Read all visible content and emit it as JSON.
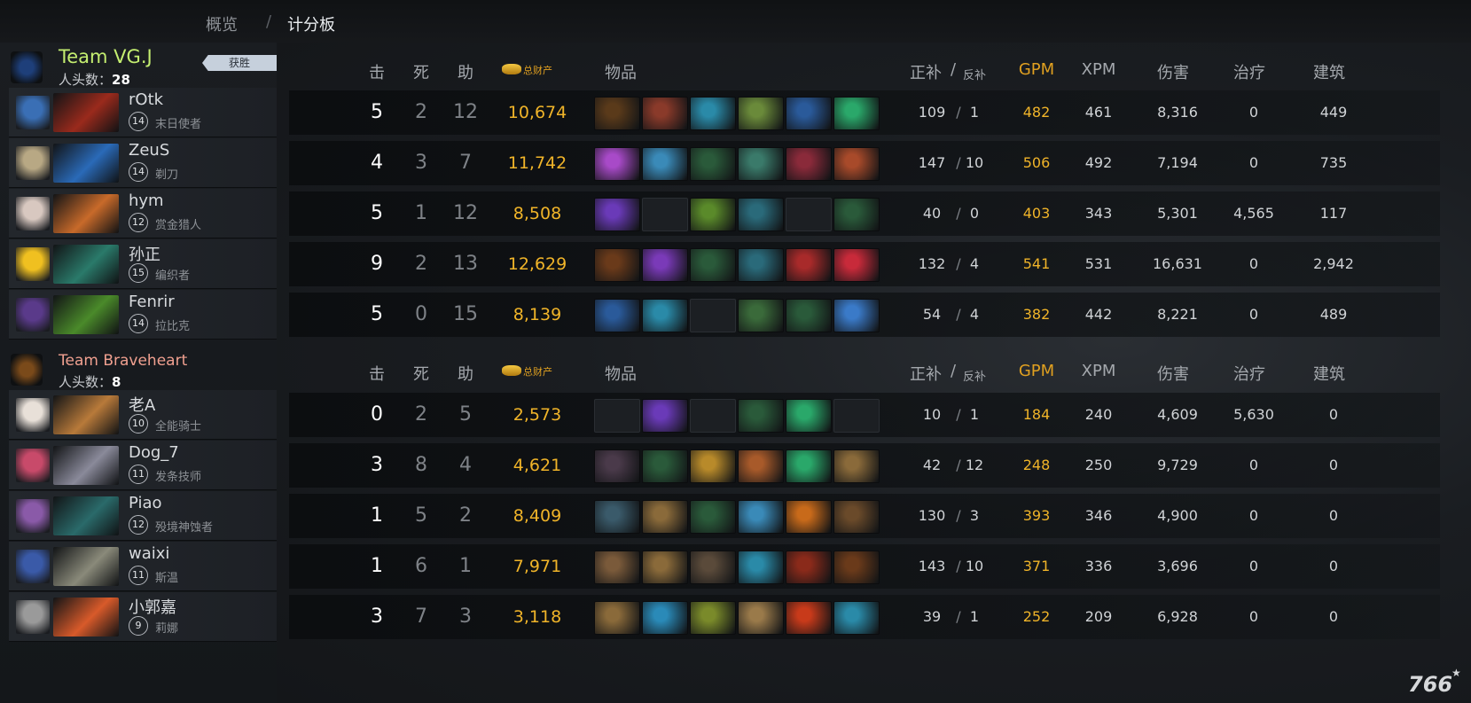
{
  "nav": {
    "overview_label": "概览",
    "separator": "/",
    "scoreboard_label": "计分板"
  },
  "columns": {
    "kills": "击",
    "deaths": "死",
    "assists": "助",
    "networth": "总财产",
    "items": "物品",
    "last_hits": "正补",
    "cs_separator": "/",
    "denies": "反补",
    "gpm": "GPM",
    "xpm": "XPM",
    "damage": "伤害",
    "healing": "治疗",
    "building": "建筑"
  },
  "teams": [
    {
      "name": "Team VG.J",
      "name_color": "#c4ee70",
      "kills_label": "人头数：",
      "kills": "28",
      "result_tag": "获胜",
      "players": [
        {
          "name": "rOtk",
          "level": "14",
          "hero": "末日使者",
          "k": "5",
          "d": "2",
          "a": "12",
          "nw": "10,674",
          "lh": "109",
          "dn": "1",
          "gpm": "482",
          "xpm": "461",
          "dmg": "8,316",
          "heal": "0",
          "bld": "449",
          "avatar_color": "#3a6fb5",
          "hero_color": "#9a2a1c",
          "items": [
            {
              "icon": "claw-icon",
              "color": "#5a3a1a"
            },
            {
              "icon": "armor-icon",
              "color": "#8a3a2a"
            },
            {
              "icon": "axe-icon",
              "color": "#2a8aa8"
            },
            {
              "icon": "drum-icon",
              "color": "#6a8a3a"
            },
            {
              "icon": "dragon-icon",
              "color": "#2a5a9a"
            },
            {
              "icon": "boots-icon",
              "color": "#2aa86a"
            }
          ]
        },
        {
          "name": "ZeuS",
          "level": "14",
          "hero": "剃刀",
          "k": "4",
          "d": "3",
          "a": "7",
          "nw": "11,742",
          "lh": "147",
          "dn": "10",
          "gpm": "506",
          "xpm": "492",
          "dmg": "7,194",
          "heal": "0",
          "bld": "735",
          "avatar_color": "#b8a884",
          "hero_color": "#2a6ab8",
          "items": [
            {
              "icon": "orb-icon",
              "color": "#a84ac8"
            },
            {
              "icon": "bottle-icon",
              "color": "#3a8ab8"
            },
            {
              "icon": "staff-icon",
              "color": "#2a5a3a"
            },
            {
              "icon": "crown-icon",
              "color": "#3a7a6a"
            },
            {
              "icon": "blade-icon",
              "color": "#8a2a3a"
            },
            {
              "icon": "cape-icon",
              "color": "#a84a2a"
            }
          ]
        },
        {
          "name": "hym",
          "level": "12",
          "hero": "赏金猎人",
          "k": "5",
          "d": "1",
          "a": "12",
          "nw": "8,508",
          "lh": "40",
          "dn": "0",
          "gpm": "403",
          "xpm": "343",
          "dmg": "5,301",
          "heal": "4,565",
          "bld": "117",
          "avatar_color": "#d8c8c0",
          "hero_color": "#c86a2a",
          "items": [
            {
              "icon": "orb-icon",
              "color": "#6a3ab8"
            },
            {
              "icon": "empty",
              "color": ""
            },
            {
              "icon": "mask-icon",
              "color": "#5a8a2a"
            },
            {
              "icon": "crown-icon",
              "color": "#2a6a7a"
            },
            {
              "icon": "empty",
              "color": ""
            },
            {
              "icon": "staff-icon",
              "color": "#2a5a3a"
            }
          ]
        },
        {
          "name": "孙正",
          "level": "15",
          "hero": "编织者",
          "k": "9",
          "d": "2",
          "a": "13",
          "nw": "12,629",
          "lh": "132",
          "dn": "4",
          "gpm": "541",
          "xpm": "531",
          "dmg": "16,631",
          "heal": "0",
          "bld": "2,942",
          "avatar_color": "#f0c020",
          "hero_color": "#2a7a6a",
          "items": [
            {
              "icon": "boots-icon",
              "color": "#6a3a1a"
            },
            {
              "icon": "sword-icon",
              "color": "#7a3ab8"
            },
            {
              "icon": "staff-icon",
              "color": "#2a5a3a"
            },
            {
              "icon": "crown-icon",
              "color": "#2a6a7a"
            },
            {
              "icon": "blade-icon",
              "color": "#a82a2a"
            },
            {
              "icon": "cape-icon",
              "color": "#c82a3a"
            }
          ]
        },
        {
          "name": "Fenrir",
          "level": "14",
          "hero": "拉比克",
          "k": "5",
          "d": "0",
          "a": "15",
          "nw": "8,139",
          "lh": "54",
          "dn": "4",
          "gpm": "382",
          "xpm": "442",
          "dmg": "8,221",
          "heal": "0",
          "bld": "489",
          "avatar_color": "#5a3a8a",
          "hero_color": "#4a8a2a",
          "items": [
            {
              "icon": "amulet-icon",
              "color": "#2a5a9a"
            },
            {
              "icon": "wind-icon",
              "color": "#2a8aa8"
            },
            {
              "icon": "empty",
              "color": ""
            },
            {
              "icon": "wand-icon",
              "color": "#3a6a3a"
            },
            {
              "icon": "staff-icon",
              "color": "#2a5a3a"
            },
            {
              "icon": "orb-icon",
              "color": "#3a7ac8"
            }
          ]
        }
      ]
    },
    {
      "name": "Team Braveheart",
      "name_color": "#f0a090",
      "kills_label": "人头数：",
      "kills": "8",
      "players": [
        {
          "name": "老A",
          "level": "10",
          "hero": "全能骑士",
          "k": "0",
          "d": "2",
          "a": "5",
          "nw": "2,573",
          "lh": "10",
          "dn": "1",
          "gpm": "184",
          "xpm": "240",
          "dmg": "4,609",
          "heal": "5,630",
          "bld": "0",
          "avatar_color": "#e8e0d8",
          "hero_color": "#b87a3a",
          "items": [
            {
              "icon": "empty",
              "color": ""
            },
            {
              "icon": "orb-icon",
              "color": "#6a3ab8"
            },
            {
              "icon": "empty",
              "color": ""
            },
            {
              "icon": "staff-icon",
              "color": "#2a5a3a"
            },
            {
              "icon": "boots-icon",
              "color": "#2aa86a"
            },
            {
              "icon": "empty",
              "color": ""
            }
          ]
        },
        {
          "name": "Dog_7",
          "level": "11",
          "hero": "发条技师",
          "k": "3",
          "d": "8",
          "a": "4",
          "nw": "4,621",
          "lh": "42",
          "dn": "12",
          "gpm": "248",
          "xpm": "250",
          "dmg": "9,729",
          "heal": "0",
          "bld": "0",
          "avatar_color": "#c84a6a",
          "hero_color": "#8a8a9a",
          "items": [
            {
              "icon": "spike-icon",
              "color": "#4a3a4a"
            },
            {
              "icon": "staff-icon",
              "color": "#2a5a3a"
            },
            {
              "icon": "pouch-icon",
              "color": "#b88a2a"
            },
            {
              "icon": "ball-icon",
              "color": "#a85a2a"
            },
            {
              "icon": "boots-icon",
              "color": "#2aa86a"
            },
            {
              "icon": "scroll-icon",
              "color": "#8a6a3a"
            }
          ]
        },
        {
          "name": "Piao",
          "level": "12",
          "hero": "殁境神蚀者",
          "k": "1",
          "d": "5",
          "a": "2",
          "nw": "8,409",
          "lh": "130",
          "dn": "3",
          "gpm": "393",
          "xpm": "346",
          "dmg": "4,900",
          "heal": "0",
          "bld": "0",
          "avatar_color": "#8a5aa8",
          "hero_color": "#2a6a6a",
          "items": [
            {
              "icon": "axe-icon",
              "color": "#3a5a6a"
            },
            {
              "icon": "scroll-icon",
              "color": "#8a6a3a"
            },
            {
              "icon": "staff-icon",
              "color": "#2a5a3a"
            },
            {
              "icon": "bottle-icon",
              "color": "#3a8ab8"
            },
            {
              "icon": "fire-icon",
              "color": "#c86a1a"
            },
            {
              "icon": "boots-icon",
              "color": "#6a4a2a"
            }
          ]
        },
        {
          "name": "waixi",
          "level": "11",
          "hero": "斯温",
          "k": "1",
          "d": "6",
          "a": "1",
          "nw": "7,971",
          "lh": "143",
          "dn": "10",
          "gpm": "371",
          "xpm": "336",
          "dmg": "3,696",
          "heal": "0",
          "bld": "0",
          "avatar_color": "#3a5aa8",
          "hero_color": "#8a8a7a",
          "items": [
            {
              "icon": "hatchet-icon",
              "color": "#7a5a3a"
            },
            {
              "icon": "scroll-icon",
              "color": "#8a6a3a"
            },
            {
              "icon": "club-icon",
              "color": "#5a4a3a"
            },
            {
              "icon": "axe-icon",
              "color": "#2a8aa8"
            },
            {
              "icon": "hood-icon",
              "color": "#8a2a1a"
            },
            {
              "icon": "boots-icon",
              "color": "#6a3a1a"
            }
          ]
        },
        {
          "name": "小郭嘉",
          "level": "9",
          "hero": "莉娜",
          "k": "3",
          "d": "7",
          "a": "3",
          "nw": "3,118",
          "lh": "39",
          "dn": "1",
          "gpm": "252",
          "xpm": "209",
          "dmg": "6,928",
          "heal": "0",
          "bld": "0",
          "avatar_color": "#9a9a9a",
          "hero_color": "#d85a2a",
          "items": [
            {
              "icon": "scroll-icon",
              "color": "#8a6a3a"
            },
            {
              "icon": "bottle-icon",
              "color": "#2a8ab8"
            },
            {
              "icon": "frog-icon",
              "color": "#7a8a2a"
            },
            {
              "icon": "map-icon",
              "color": "#9a7a4a"
            },
            {
              "icon": "ring-icon",
              "color": "#c83a1a"
            },
            {
              "icon": "wind-icon",
              "color": "#2a8aa8"
            }
          ]
        }
      ]
    }
  ],
  "watermark": "766",
  "watermark_star": "★"
}
